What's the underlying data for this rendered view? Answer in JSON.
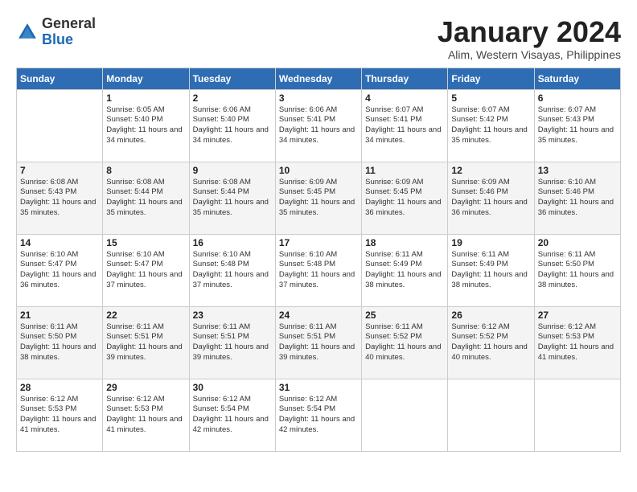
{
  "header": {
    "logo_line1": "General",
    "logo_line2": "Blue",
    "month": "January 2024",
    "location": "Alim, Western Visayas, Philippines"
  },
  "weekdays": [
    "Sunday",
    "Monday",
    "Tuesday",
    "Wednesday",
    "Thursday",
    "Friday",
    "Saturday"
  ],
  "weeks": [
    [
      {
        "day": "",
        "sunrise": "",
        "sunset": "",
        "daylight": ""
      },
      {
        "day": "1",
        "sunrise": "6:05 AM",
        "sunset": "5:40 PM",
        "daylight": "11 hours and 34 minutes."
      },
      {
        "day": "2",
        "sunrise": "6:06 AM",
        "sunset": "5:40 PM",
        "daylight": "11 hours and 34 minutes."
      },
      {
        "day": "3",
        "sunrise": "6:06 AM",
        "sunset": "5:41 PM",
        "daylight": "11 hours and 34 minutes."
      },
      {
        "day": "4",
        "sunrise": "6:07 AM",
        "sunset": "5:41 PM",
        "daylight": "11 hours and 34 minutes."
      },
      {
        "day": "5",
        "sunrise": "6:07 AM",
        "sunset": "5:42 PM",
        "daylight": "11 hours and 35 minutes."
      },
      {
        "day": "6",
        "sunrise": "6:07 AM",
        "sunset": "5:43 PM",
        "daylight": "11 hours and 35 minutes."
      }
    ],
    [
      {
        "day": "7",
        "sunrise": "6:08 AM",
        "sunset": "5:43 PM",
        "daylight": "11 hours and 35 minutes."
      },
      {
        "day": "8",
        "sunrise": "6:08 AM",
        "sunset": "5:44 PM",
        "daylight": "11 hours and 35 minutes."
      },
      {
        "day": "9",
        "sunrise": "6:08 AM",
        "sunset": "5:44 PM",
        "daylight": "11 hours and 35 minutes."
      },
      {
        "day": "10",
        "sunrise": "6:09 AM",
        "sunset": "5:45 PM",
        "daylight": "11 hours and 35 minutes."
      },
      {
        "day": "11",
        "sunrise": "6:09 AM",
        "sunset": "5:45 PM",
        "daylight": "11 hours and 36 minutes."
      },
      {
        "day": "12",
        "sunrise": "6:09 AM",
        "sunset": "5:46 PM",
        "daylight": "11 hours and 36 minutes."
      },
      {
        "day": "13",
        "sunrise": "6:10 AM",
        "sunset": "5:46 PM",
        "daylight": "11 hours and 36 minutes."
      }
    ],
    [
      {
        "day": "14",
        "sunrise": "6:10 AM",
        "sunset": "5:47 PM",
        "daylight": "11 hours and 36 minutes."
      },
      {
        "day": "15",
        "sunrise": "6:10 AM",
        "sunset": "5:47 PM",
        "daylight": "11 hours and 37 minutes."
      },
      {
        "day": "16",
        "sunrise": "6:10 AM",
        "sunset": "5:48 PM",
        "daylight": "11 hours and 37 minutes."
      },
      {
        "day": "17",
        "sunrise": "6:10 AM",
        "sunset": "5:48 PM",
        "daylight": "11 hours and 37 minutes."
      },
      {
        "day": "18",
        "sunrise": "6:11 AM",
        "sunset": "5:49 PM",
        "daylight": "11 hours and 38 minutes."
      },
      {
        "day": "19",
        "sunrise": "6:11 AM",
        "sunset": "5:49 PM",
        "daylight": "11 hours and 38 minutes."
      },
      {
        "day": "20",
        "sunrise": "6:11 AM",
        "sunset": "5:50 PM",
        "daylight": "11 hours and 38 minutes."
      }
    ],
    [
      {
        "day": "21",
        "sunrise": "6:11 AM",
        "sunset": "5:50 PM",
        "daylight": "11 hours and 38 minutes."
      },
      {
        "day": "22",
        "sunrise": "6:11 AM",
        "sunset": "5:51 PM",
        "daylight": "11 hours and 39 minutes."
      },
      {
        "day": "23",
        "sunrise": "6:11 AM",
        "sunset": "5:51 PM",
        "daylight": "11 hours and 39 minutes."
      },
      {
        "day": "24",
        "sunrise": "6:11 AM",
        "sunset": "5:51 PM",
        "daylight": "11 hours and 39 minutes."
      },
      {
        "day": "25",
        "sunrise": "6:11 AM",
        "sunset": "5:52 PM",
        "daylight": "11 hours and 40 minutes."
      },
      {
        "day": "26",
        "sunrise": "6:12 AM",
        "sunset": "5:52 PM",
        "daylight": "11 hours and 40 minutes."
      },
      {
        "day": "27",
        "sunrise": "6:12 AM",
        "sunset": "5:53 PM",
        "daylight": "11 hours and 41 minutes."
      }
    ],
    [
      {
        "day": "28",
        "sunrise": "6:12 AM",
        "sunset": "5:53 PM",
        "daylight": "11 hours and 41 minutes."
      },
      {
        "day": "29",
        "sunrise": "6:12 AM",
        "sunset": "5:53 PM",
        "daylight": "11 hours and 41 minutes."
      },
      {
        "day": "30",
        "sunrise": "6:12 AM",
        "sunset": "5:54 PM",
        "daylight": "11 hours and 42 minutes."
      },
      {
        "day": "31",
        "sunrise": "6:12 AM",
        "sunset": "5:54 PM",
        "daylight": "11 hours and 42 minutes."
      },
      {
        "day": "",
        "sunrise": "",
        "sunset": "",
        "daylight": ""
      },
      {
        "day": "",
        "sunrise": "",
        "sunset": "",
        "daylight": ""
      },
      {
        "day": "",
        "sunrise": "",
        "sunset": "",
        "daylight": ""
      }
    ]
  ],
  "labels": {
    "sunrise_prefix": "Sunrise: ",
    "sunset_prefix": "Sunset: ",
    "daylight_prefix": "Daylight: "
  }
}
